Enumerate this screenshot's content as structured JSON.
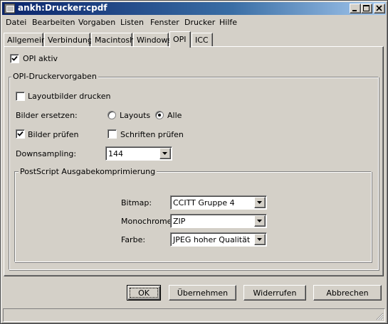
{
  "window": {
    "title": "ankh:Drucker:cpdf"
  },
  "menu": [
    "Datei",
    "Bearbeiten",
    "Vorgaben",
    "Listen",
    "Fenster",
    "Drucker",
    "Hilfe"
  ],
  "tabs": [
    "Allgemein",
    "Verbindung",
    "Macintosh",
    "Windows",
    "OPI",
    "ICC"
  ],
  "active_tab": "OPI",
  "opi": {
    "opi_active": {
      "label": "OPI aktiv",
      "checked": true
    },
    "group_title": "OPI-Druckervorgaben",
    "layout_images": {
      "label": "Layoutbilder drucken",
      "checked": false
    },
    "replace_label": "Bilder ersetzen:",
    "replace_options": [
      {
        "label": "Layouts",
        "selected": false
      },
      {
        "label": "Alle",
        "selected": true
      }
    ],
    "check_images": {
      "label": "Bilder prüfen",
      "checked": true
    },
    "check_fonts": {
      "label": "Schriften prüfen",
      "checked": false
    },
    "downsampling": {
      "label": "Downsampling:",
      "value": "144"
    },
    "compression": {
      "title": "PostScript Ausgabekomprimierung",
      "bitmap": {
        "label": "Bitmap:",
        "value": "CCITT Gruppe 4"
      },
      "monochrome": {
        "label": "Monochrome:",
        "value": "ZIP"
      },
      "color": {
        "label": "Farbe:",
        "value": "JPEG hoher Qualität"
      }
    }
  },
  "buttons": {
    "ok": "OK",
    "apply": "Übernehmen",
    "revert": "Widerrufen",
    "cancel": "Abbrechen"
  }
}
